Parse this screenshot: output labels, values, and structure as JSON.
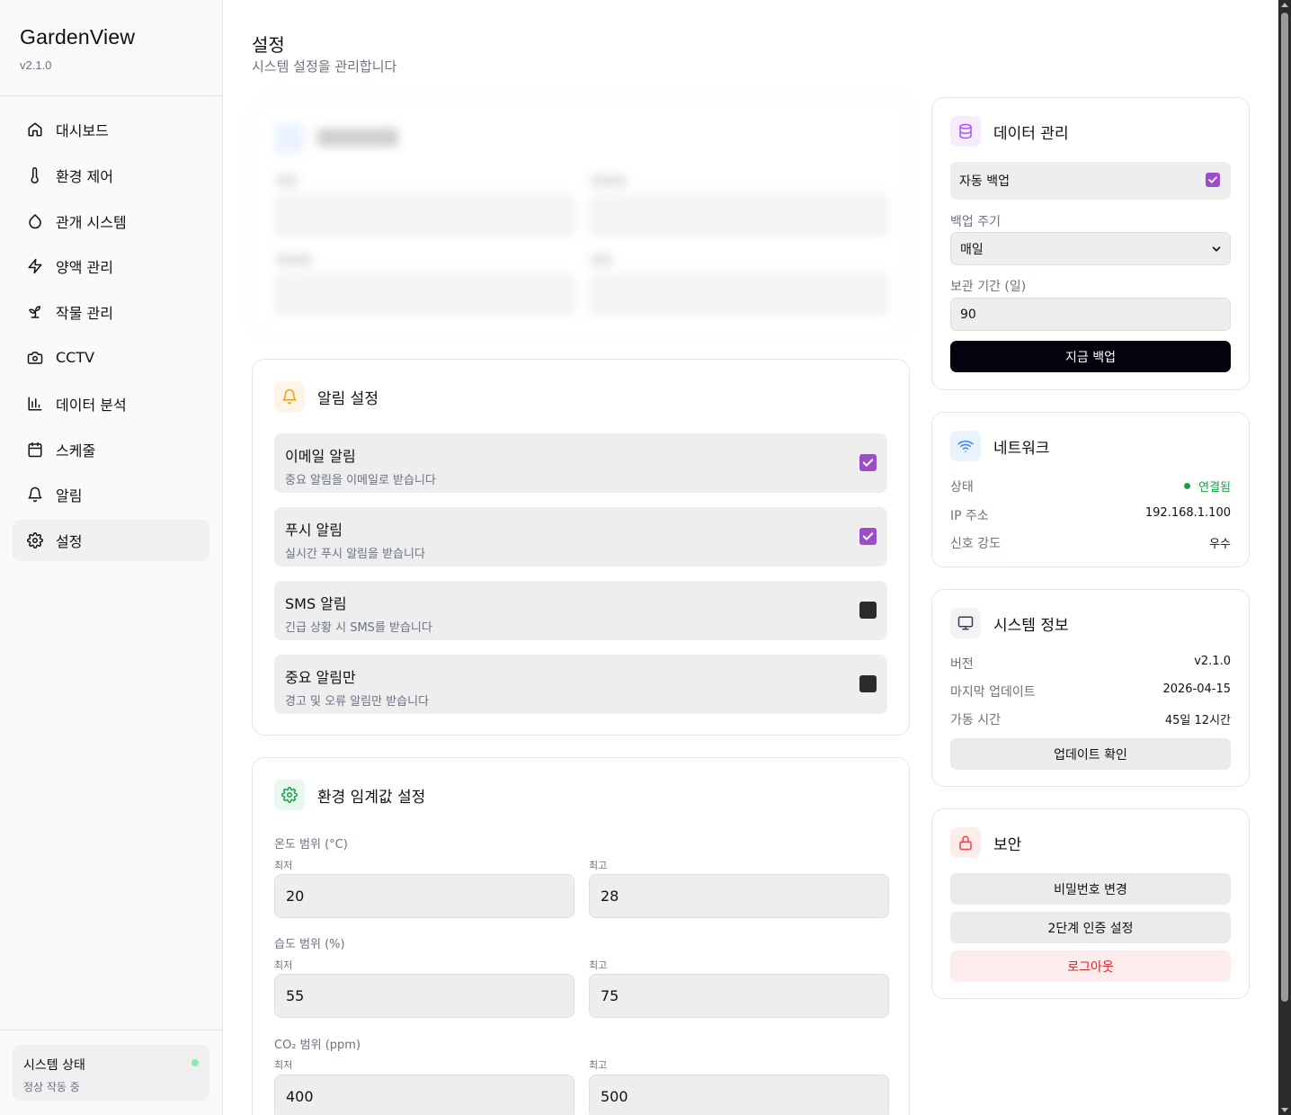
{
  "app": {
    "name": "GardenView",
    "version": "v2.1.0"
  },
  "sidebar": {
    "items": [
      {
        "label": "대시보드",
        "icon": "home-icon"
      },
      {
        "label": "환경 제어",
        "icon": "thermometer-icon"
      },
      {
        "label": "관개 시스템",
        "icon": "droplet-icon"
      },
      {
        "label": "양액 관리",
        "icon": "zap-icon"
      },
      {
        "label": "작물 관리",
        "icon": "sprout-icon"
      },
      {
        "label": "CCTV",
        "icon": "camera-icon"
      },
      {
        "label": "데이터 분석",
        "icon": "bar-chart-icon"
      },
      {
        "label": "스케줄",
        "icon": "calendar-icon"
      },
      {
        "label": "알림",
        "icon": "bell-icon"
      },
      {
        "label": "설정",
        "icon": "gear-icon",
        "active": true
      }
    ],
    "status": {
      "title": "시스템 상태",
      "subtitle": "정상 작동 중",
      "dot_color": "#86efac"
    }
  },
  "page": {
    "title": "설정",
    "subtitle": "시스템 설정을 관리합니다"
  },
  "notifications": {
    "title": "알림 설정",
    "items": [
      {
        "title": "이메일 알림",
        "desc": "중요 알림을 이메일로 받습니다",
        "checked": true
      },
      {
        "title": "푸시 알림",
        "desc": "실시간 푸시 알림을 받습니다",
        "checked": true
      },
      {
        "title": "SMS 알림",
        "desc": "긴급 상황 시 SMS를 받습니다",
        "checked": false
      },
      {
        "title": "중요 알림만",
        "desc": "경고 및 오류 알림만 받습니다",
        "checked": false
      }
    ]
  },
  "thresholds": {
    "title": "환경 임계값 설정",
    "min_label": "최저",
    "max_label": "최고",
    "groups": [
      {
        "label": "온도 범위 (°C)",
        "min": "20",
        "max": "28"
      },
      {
        "label": "습도 범위 (%)",
        "min": "55",
        "max": "75"
      },
      {
        "label": "CO₂ 범위 (ppm)",
        "min": "400",
        "max": "500"
      }
    ]
  },
  "data_mgmt": {
    "title": "데이터 관리",
    "auto_backup_label": "자동 백업",
    "auto_backup_checked": true,
    "backup_cycle_label": "백업 주기",
    "backup_cycle_value": "매일",
    "retention_label": "보관 기간 (일)",
    "retention_value": "90",
    "backup_now_label": "지금 백업"
  },
  "network": {
    "title": "네트워크",
    "rows": [
      {
        "label": "상태",
        "value": "연결됨"
      },
      {
        "label": "IP 주소",
        "value": "192.168.1.100"
      },
      {
        "label": "신호 강도",
        "value": "우수"
      }
    ],
    "status_color": "#16a34a"
  },
  "system_info": {
    "title": "시스템 정보",
    "rows": [
      {
        "label": "버전",
        "value": "v2.1.0"
      },
      {
        "label": "마지막 업데이트",
        "value": "2026-04-15"
      },
      {
        "label": "가동 시간",
        "value": "45일 12시간"
      }
    ],
    "update_check_label": "업데이트 확인"
  },
  "security": {
    "title": "보안",
    "change_password_label": "비밀번호 변경",
    "two_factor_label": "2단계 인증 설정",
    "logout_label": "로그아웃"
  },
  "colors": {
    "accent_purple": "#9b4dca",
    "dark_button": "#03030f",
    "danger": "#dc2626",
    "success": "#16a34a"
  }
}
